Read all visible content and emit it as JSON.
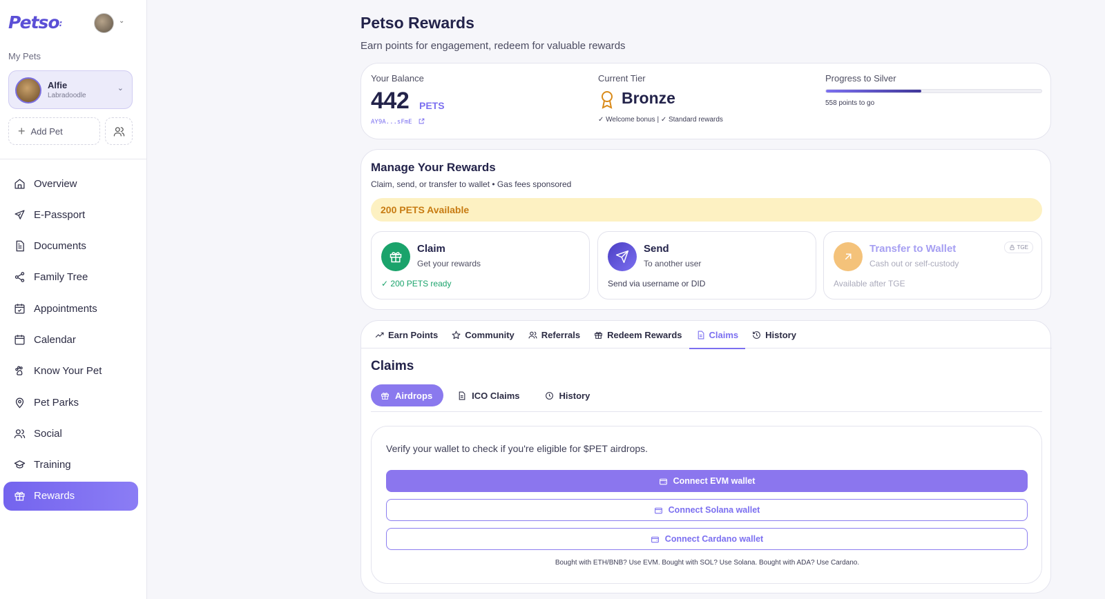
{
  "sidebar": {
    "logo": "Petso",
    "my_pets_label": "My Pets",
    "pet": {
      "name": "Alfie",
      "breed": "Labradoodle"
    },
    "add_pet_label": "Add Pet",
    "nav": [
      {
        "label": "Overview",
        "icon": "home-icon"
      },
      {
        "label": "E-Passport",
        "icon": "plane-icon"
      },
      {
        "label": "Documents",
        "icon": "document-icon"
      },
      {
        "label": "Family Tree",
        "icon": "share-icon"
      },
      {
        "label": "Appointments",
        "icon": "calendar-check-icon"
      },
      {
        "label": "Calendar",
        "icon": "calendar-icon"
      },
      {
        "label": "Know Your Pet",
        "icon": "paw-icon"
      },
      {
        "label": "Pet Parks",
        "icon": "map-pin-icon"
      },
      {
        "label": "Social",
        "icon": "users-icon"
      },
      {
        "label": "Training",
        "icon": "graduation-cap-icon"
      },
      {
        "label": "Rewards",
        "icon": "gift-icon",
        "active": true
      }
    ]
  },
  "header": {
    "title": "Petso Rewards",
    "subtitle": "Earn points for engagement, redeem for valuable rewards"
  },
  "balance": {
    "label": "Your Balance",
    "amount": "442",
    "unit": "PETS",
    "address": "AY9A...sFmE",
    "tier_label": "Current Tier",
    "tier": "Bronze",
    "tier_perks": "✓ Welcome bonus | ✓ Standard rewards",
    "progress_label": "Progress to Silver",
    "progress_percent": 44.2,
    "progress_sub": "558 points to go"
  },
  "manage": {
    "title": "Manage Your Rewards",
    "subtitle": "Claim, send, or transfer to wallet • Gas fees sponsored",
    "available": "200 PETS Available",
    "actions": [
      {
        "title": "Claim",
        "subtitle": "Get your rewards",
        "footer": "✓ 200 PETS ready",
        "color": "#1aa36b"
      },
      {
        "title": "Send",
        "subtitle": "To another user",
        "footer": "Send via username or DID",
        "color": "#5b4fd6"
      },
      {
        "title": "Transfer to Wallet",
        "subtitle": "Cash out or self-custody",
        "footer": "Available after TGE",
        "badge": "TGE",
        "color": "#f4c27a"
      }
    ]
  },
  "tabs": [
    {
      "label": "Earn Points",
      "icon": "trending-up-icon"
    },
    {
      "label": "Community",
      "icon": "star-icon"
    },
    {
      "label": "Referrals",
      "icon": "users-icon"
    },
    {
      "label": "Redeem Rewards",
      "icon": "gift-icon"
    },
    {
      "label": "Claims",
      "icon": "document-icon",
      "active": true
    },
    {
      "label": "History",
      "icon": "history-icon"
    }
  ],
  "claims": {
    "title": "Claims",
    "subtabs": [
      {
        "label": "Airdrops",
        "icon": "gift-icon",
        "active": true
      },
      {
        "label": "ICO Claims",
        "icon": "document-icon"
      },
      {
        "label": "History",
        "icon": "clock-icon"
      }
    ],
    "verify_text": "Verify your wallet to check if you're eligible for $PET airdrops.",
    "buttons": [
      {
        "label": "Connect EVM wallet",
        "style": "primary"
      },
      {
        "label": "Connect Solana wallet",
        "style": "outline"
      },
      {
        "label": "Connect Cardano wallet",
        "style": "outline"
      }
    ],
    "hint": "Bought with ETH/BNB? Use EVM. Bought with SOL? Use Solana. Bought with ADA? Use Cardano."
  },
  "colors": {
    "accent": "#7b6ff0",
    "claim_green": "#1aa36b",
    "available_bg": "#fdf1c2",
    "available_text": "#c77b12"
  }
}
